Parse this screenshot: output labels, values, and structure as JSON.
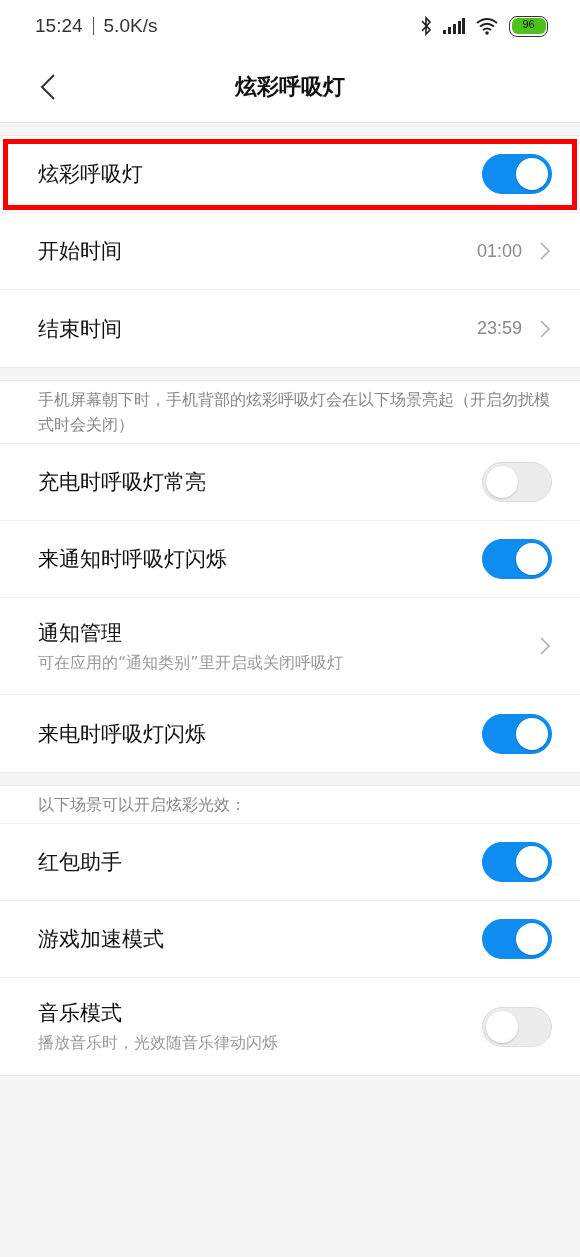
{
  "status_bar": {
    "time": "15:24",
    "speed": "5.0K/s",
    "battery": "96"
  },
  "header": {
    "title": "炫彩呼吸灯"
  },
  "sections": [
    {
      "rows": [
        {
          "kind": "toggle",
          "label": "炫彩呼吸灯",
          "on": true,
          "highlighted": true
        },
        {
          "kind": "link",
          "label": "开始时间",
          "value": "01:00",
          "highlighted": false
        },
        {
          "kind": "link",
          "label": "结束时间",
          "value": "23:59",
          "highlighted": false
        }
      ]
    },
    {
      "note": "手机屏幕朝下时，手机背部的炫彩呼吸灯会在以下场景亮起（开启勿扰模式时会关闭）",
      "rows": [
        {
          "kind": "toggle",
          "label": "充电时呼吸灯常亮",
          "on": false,
          "highlighted": false
        },
        {
          "kind": "toggle",
          "label": "来通知时呼吸灯闪烁",
          "on": true,
          "highlighted": false
        },
        {
          "kind": "link",
          "label": "通知管理",
          "subtitle": "可在应用的“通知类别”里开启或关闭呼吸灯",
          "highlighted": false
        },
        {
          "kind": "toggle",
          "label": "来电时呼吸灯闪烁",
          "on": true,
          "highlighted": false
        }
      ]
    },
    {
      "note": "以下场景可以开启炫彩光效：",
      "rows": [
        {
          "kind": "toggle",
          "label": "红包助手",
          "on": true,
          "highlighted": false
        },
        {
          "kind": "toggle",
          "label": "游戏加速模式",
          "on": true,
          "highlighted": false
        },
        {
          "kind": "toggle",
          "label": "音乐模式",
          "subtitle": "播放音乐时，光效随音乐律动闪烁",
          "on": false,
          "highlighted": false
        }
      ]
    }
  ]
}
